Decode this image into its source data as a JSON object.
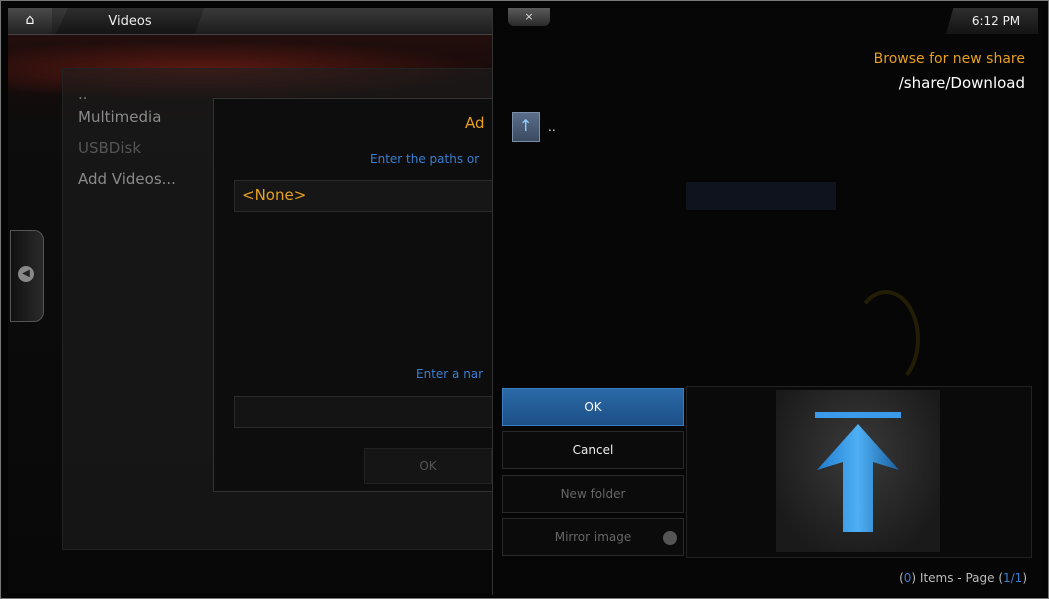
{
  "header": {
    "home_icon": "home-icon",
    "section_title": "Videos",
    "close_label": "×",
    "clock": "6:12 PM"
  },
  "sidebar": {
    "items": [
      {
        "label": ".."
      },
      {
        "label": "Multimedia"
      },
      {
        "label": "USBDisk"
      },
      {
        "label": "Add Videos..."
      }
    ]
  },
  "add_dialog": {
    "title": "Ad",
    "paths_hint": "Enter the paths or",
    "path_value": "<None>",
    "name_hint": "Enter a nar",
    "ok_label": "OK"
  },
  "browse": {
    "title": "Browse for new share",
    "current_path": "/share/Download",
    "items": [
      {
        "label": "..",
        "icon": "folder-up-icon"
      }
    ],
    "buttons": {
      "ok": "OK",
      "cancel": "Cancel",
      "new_folder": "New folder",
      "mirror_image": "Mirror image"
    },
    "footer": {
      "count": "0",
      "items_text": " Items - Page (",
      "page": "1/1",
      "close_paren": ")"
    }
  },
  "colors": {
    "accent_orange": "#e8a020",
    "accent_blue": "#3a7fd0",
    "ok_button": "#2b6aa8"
  }
}
